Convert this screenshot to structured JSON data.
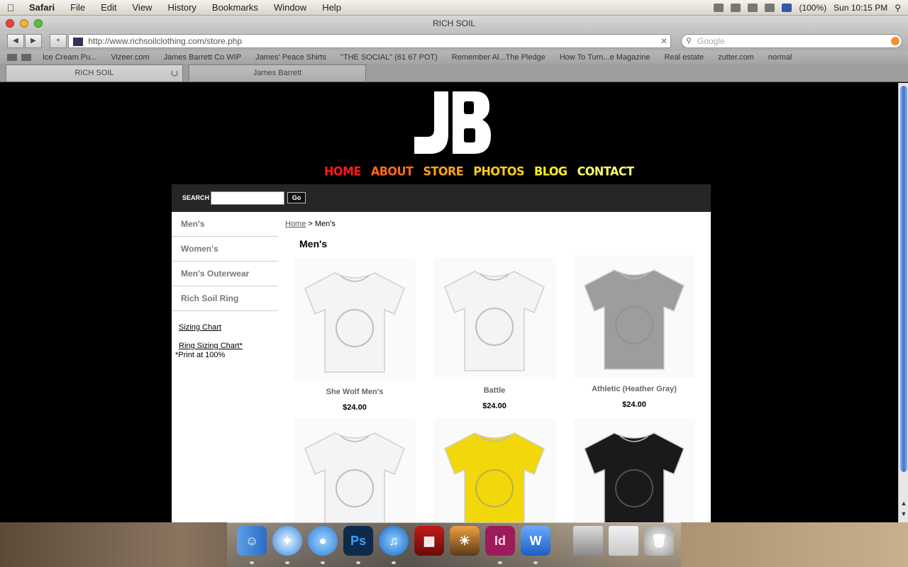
{
  "menubar": {
    "app": "Safari",
    "menus": [
      "File",
      "Edit",
      "View",
      "History",
      "Bookmarks",
      "Window",
      "Help"
    ],
    "battery": "(100%)",
    "clock": "Sun 10:15 PM"
  },
  "window": {
    "title": "RICH SOIL"
  },
  "browser": {
    "url": "http://www.richsoilclothing.com/store.php",
    "search_placeholder": "Google",
    "bookmarks": [
      "Ice Cream Pu...",
      "Vizeer.com",
      "James Barrett Co WIP",
      "James' Peace Shirts",
      "\"THE SOCIAL\" (61 67 POT)",
      "Remember Al...The Pledge",
      "How To Turn...e Magazine",
      "Real estate",
      "zutter.com",
      "normal"
    ],
    "tabs": [
      "RICH SOIL",
      "James Barrett"
    ]
  },
  "site": {
    "nav": [
      {
        "label": "HOME",
        "color": "#ff1a1a"
      },
      {
        "label": "ABOUT",
        "color": "#ff6a1a"
      },
      {
        "label": "STORE",
        "color": "#ffa31a"
      },
      {
        "label": "PHOTOS",
        "color": "#ffcc1a"
      },
      {
        "label": "BLOG",
        "color": "#fff01a"
      },
      {
        "label": "CONTACT",
        "color": "#ffff66"
      }
    ],
    "search_label": "SEARCH",
    "go_label": "Go",
    "categories": [
      "Men's",
      "Women's",
      "Men's Outerwear",
      "Rich Soil Ring"
    ],
    "sizing_chart": "Sizing Chart",
    "ring_sizing_chart": "Ring Sizing Chart*",
    "print_note": "*Print at 100%",
    "breadcrumb": {
      "home": "Home",
      "sep": " > ",
      "current": "Men's"
    },
    "page_title": "Men's",
    "products": [
      {
        "name": "She Wolf Men's",
        "price": "$24.00",
        "shirt_color": "#f4f4f4"
      },
      {
        "name": "Battle",
        "price": "$24.00",
        "shirt_color": "#f4f4f4"
      },
      {
        "name": "Athletic (Heather Gray)",
        "price": "$24.00",
        "shirt_color": "#9d9d9d"
      },
      {
        "name": "",
        "price": "",
        "shirt_color": "#f4f4f4"
      },
      {
        "name": "",
        "price": "",
        "shirt_color": "#f2d70a"
      },
      {
        "name": "",
        "price": "",
        "shirt_color": "#1a1a1a"
      }
    ]
  },
  "dock": [
    "finder-icon",
    "safari-icon",
    "ichat-icon",
    "photoshop-icon",
    "itunes-icon",
    "photo-booth-icon",
    "iphoto-icon",
    "indesign-icon",
    "word-icon"
  ],
  "dock_labels": {
    "photoshop": "Ps",
    "indesign": "Id"
  }
}
